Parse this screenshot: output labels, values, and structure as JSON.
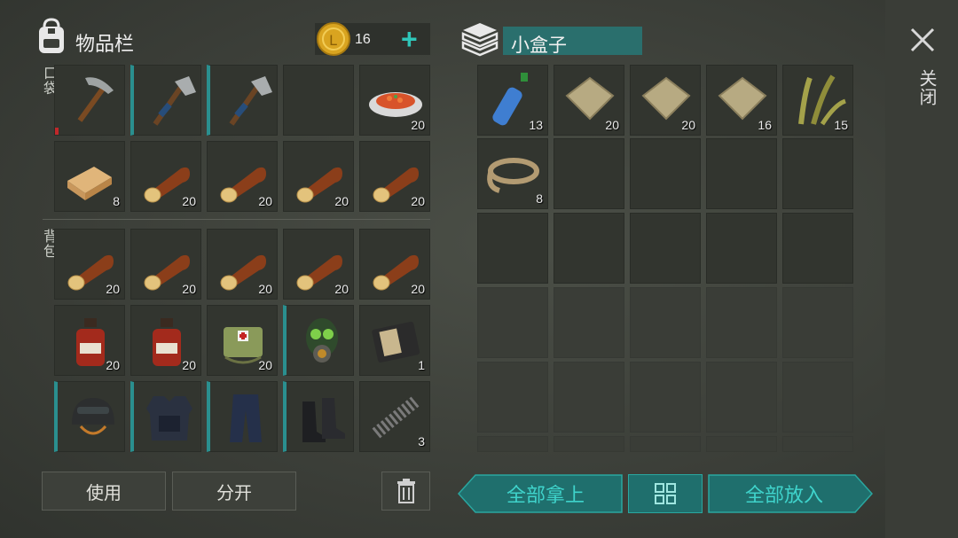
{
  "inventory": {
    "title": "物品栏",
    "coins": "16",
    "pocket_label": "口袋",
    "backpack_label": "背包",
    "pocket_slots": [
      {
        "icon": "pickaxe-icon",
        "count": "",
        "selected": false,
        "durability_low": true
      },
      {
        "icon": "hatchet-icon",
        "count": "",
        "selected": true
      },
      {
        "icon": "hatchet-icon",
        "count": "",
        "selected": true
      },
      {
        "icon": "",
        "count": ""
      },
      {
        "icon": "cooked-meal-icon",
        "count": "20"
      },
      {
        "icon": "plank-icon",
        "count": "8"
      },
      {
        "icon": "log-icon",
        "count": "20"
      },
      {
        "icon": "log-icon",
        "count": "20"
      },
      {
        "icon": "log-icon",
        "count": "20"
      },
      {
        "icon": "log-icon",
        "count": "20"
      }
    ],
    "backpack_slots": [
      {
        "icon": "log-icon",
        "count": "20"
      },
      {
        "icon": "log-icon",
        "count": "20"
      },
      {
        "icon": "log-icon",
        "count": "20"
      },
      {
        "icon": "log-icon",
        "count": "20"
      },
      {
        "icon": "log-icon",
        "count": "20"
      },
      {
        "icon": "bottle-icon",
        "count": "20"
      },
      {
        "icon": "bottle-icon",
        "count": "20"
      },
      {
        "icon": "medkit-bag-icon",
        "count": "20"
      },
      {
        "icon": "gas-mask-icon",
        "count": "",
        "selected": true
      },
      {
        "icon": "notebook-icon",
        "count": "1"
      },
      {
        "icon": "helmet-icon",
        "count": "",
        "selected": true
      },
      {
        "icon": "body-armor-icon",
        "count": "",
        "selected": true
      },
      {
        "icon": "pants-icon",
        "count": "",
        "selected": true
      },
      {
        "icon": "boots-icon",
        "count": "",
        "selected": true
      },
      {
        "icon": "spring-icon",
        "count": "3"
      }
    ],
    "use_button": "使用",
    "split_button": "分开"
  },
  "container": {
    "title": "小盒子",
    "close_label": "关闭",
    "slots": [
      {
        "icon": "water-bottle-icon",
        "count": "13"
      },
      {
        "icon": "cloth-icon",
        "count": "20"
      },
      {
        "icon": "cloth-icon",
        "count": "20"
      },
      {
        "icon": "cloth-icon",
        "count": "16"
      },
      {
        "icon": "plant-fiber-icon",
        "count": "15"
      },
      {
        "icon": "rope-icon",
        "count": "8"
      }
    ],
    "take_all_button": "全部拿上",
    "put_all_button": "全部放入"
  }
}
